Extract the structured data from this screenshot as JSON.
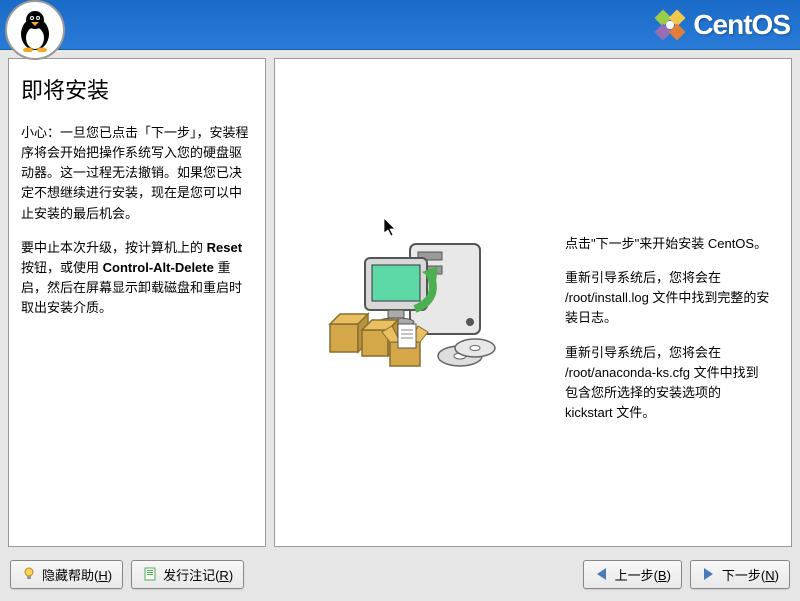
{
  "header": {
    "brand": "CentOS"
  },
  "sidebar": {
    "title": "即将安装",
    "paragraph1_prefix": "小心：一旦您已点击「下一步」，安装程序将会开始把操作系统写入您的硬盘驱动器。这一过程无法撤销。如果您已决定不想继续进行安装，现在是您可以中止安装的最后机会。",
    "paragraph2_part1": "要中止本次升级，按计算机上的 ",
    "paragraph2_reset": "Reset",
    "paragraph2_part2": " 按钮，或使用 ",
    "paragraph2_cad": "Control-Alt-Delete",
    "paragraph2_part3": " 重启，然后在屏幕显示卸载磁盘和重启时取出安装介质。"
  },
  "content": {
    "line1": "点击\"下一步\"来开始安装 CentOS。",
    "line2": "重新引导系统后，您将会在 /root/install.log 文件中找到完整的安装日志。",
    "line3": "重新引导系统后，您将会在 /root/anaconda-ks.cfg 文件中找到包含您所选择的安装选项的 kickstart 文件。"
  },
  "footer": {
    "hide_help_label": "隐藏帮助(",
    "hide_help_key": "H",
    "release_notes_label": "发行注记(",
    "release_notes_key": "R",
    "back_label": "上一步(",
    "back_key": "B",
    "next_label": "下一步(",
    "next_key": "N",
    "close_paren": ")"
  }
}
